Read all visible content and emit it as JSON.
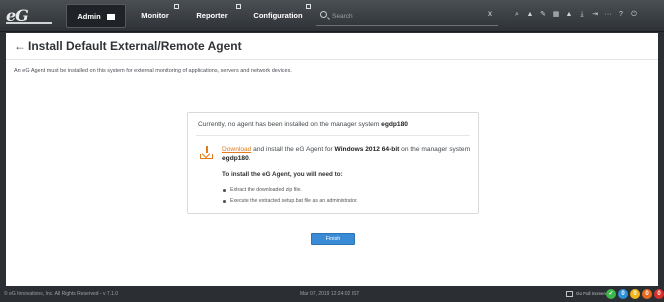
{
  "header": {
    "logo": "eG",
    "nav": [
      "Admin",
      "Monitor",
      "Reporter",
      "Configuration"
    ],
    "search_placeholder": "Search",
    "search_clear": "x",
    "toolbar_icons": [
      "search-icon",
      "alarm-icon",
      "edit-icon",
      "grid-icon",
      "user-icon",
      "download-icon",
      "logout-icon",
      "more-icon",
      "help-icon",
      "power-icon"
    ],
    "toolbar_glyphs": [
      "⌕",
      "▲",
      "✎",
      "▦",
      "▲",
      "⤓",
      "⇥",
      "···",
      "?",
      "⏻"
    ]
  },
  "page": {
    "title": "Install Default External/Remote Agent",
    "description": "An eG Agent must be installed on this system for external monitoring of applications, servers and network devices."
  },
  "card": {
    "status_prefix": "Currently, no agent has been installed on the manager system",
    "status_host": "egdp180",
    "download_link": "Download",
    "download_text_1": " and install the eG Agent for ",
    "download_os": "Windows 2012 64-bit",
    "download_text_2": " on the manager system ",
    "download_host": "egdp180",
    "download_text_3": ".",
    "install_heading": "To install the eG Agent, you will need to:",
    "steps": [
      "Extract the downloaded zip file.",
      "Execute the extracted setup.bat file as an administrator."
    ]
  },
  "finish_label": "Finish",
  "footer": {
    "copyright": "© eG Innovations, Inc. All Rights Reserved - v 7.1.0",
    "timestamp": "Mar 07, 2019 12:24:02 IST",
    "fullscreen_label": "Go Full Screen",
    "status_counts": [
      "0",
      "0",
      "0",
      "0"
    ],
    "status_colors": [
      "#3cb64a",
      "#2f8fd8",
      "#f2b51b",
      "#e96b1f",
      "#d8322b"
    ]
  }
}
